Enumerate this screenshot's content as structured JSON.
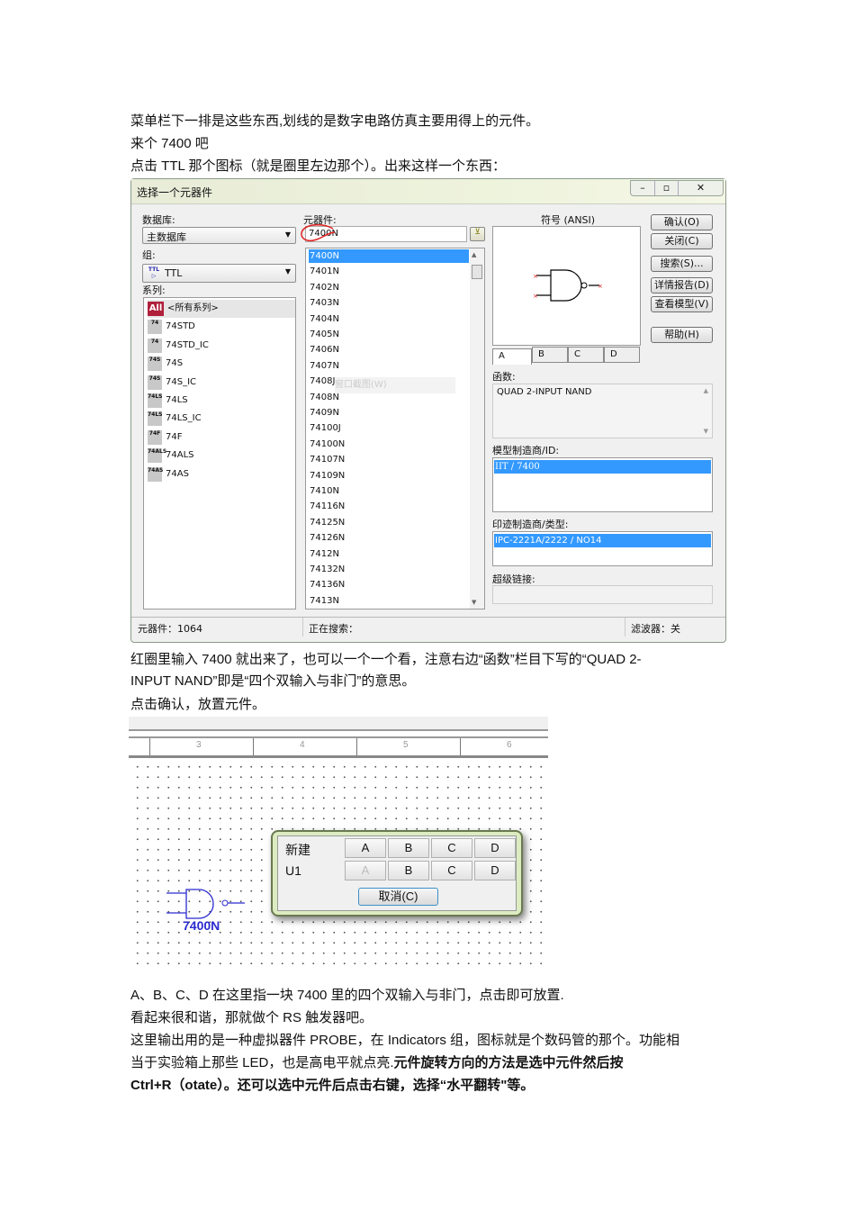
{
  "text": {
    "l1": "菜单栏下一排是这些东西,划线的是数字电路仿真主要用得上的元件。",
    "l2": "来个 7400 吧",
    "l3": "点击 TTL 那个图标（就是圈里左边那个）。出来这样一个东西：",
    "l4": "红圈里输入 7400 就出来了，也可以一个一个看，注意右边“函数”栏目下写的“QUAD 2-",
    "l5": "INPUT NAND”即是“四个双输入与非门”的意思。",
    "l6": "点击确认，放置元件。",
    "l7": "A、B、C、D 在这里指一块 7400 里的四个双输入与非门，点击即可放置.",
    "l8": "看起来很和谐，那就做个 RS 触发器吧。",
    "l9": "这里输出用的是一种虚拟器件 PROBE，在 Indicators 组，图标就是个数码管的那个。功能相",
    "l10a": "当于实验箱上那些 LED，也是高电平就点亮.",
    "l10b": "元件旋转方向的方法是选中元件然后按",
    "l11": "Ctrl+R（otate）。还可以选中元件后点击右键，选择“水平翻转\"等。"
  },
  "dialog": {
    "title": "选择一个元器件",
    "database_label": "数据库:",
    "database_value": "主数据库",
    "group_label": "组:",
    "group_value": "TTL",
    "group_icon_text": "TTL",
    "series_label": "系列:",
    "series": [
      {
        "icon": "All",
        "label": "<所有系列>"
      },
      {
        "icon": "74",
        "label": "74STD"
      },
      {
        "icon": "74",
        "label": "74STD_IC"
      },
      {
        "icon": "74S",
        "label": "74S"
      },
      {
        "icon": "74S",
        "label": "74S_IC"
      },
      {
        "icon": "74LS",
        "label": "74LS"
      },
      {
        "icon": "74LS",
        "label": "74LS_IC"
      },
      {
        "icon": "74F",
        "label": "74F"
      },
      {
        "icon": "74ALS",
        "label": "74ALS"
      },
      {
        "icon": "74AS",
        "label": "74AS"
      }
    ],
    "component_label": "元器件:",
    "component_input": "7400N",
    "components": [
      "7400N",
      "7401N",
      "7402N",
      "7403N",
      "7404N",
      "7405N",
      "7406N",
      "7407N",
      "7408J",
      "7408N",
      "7409N",
      "74100J",
      "74100N",
      "74107N",
      "74109N",
      "7410N",
      "74116N",
      "74125N",
      "74126N",
      "7412N",
      "74132N",
      "74136N",
      "7413N"
    ],
    "tooltip": "窗口截图(W)",
    "symbol_label": "符号 (ANSI)",
    "tabs": [
      "A",
      "B",
      "C",
      "D"
    ],
    "buttons": {
      "ok": "确认(O)",
      "close": "关闭(C)",
      "search": "搜索(S)...",
      "detail": "详情报告(D)",
      "model": "查看模型(V)",
      "help": "帮助(H)"
    },
    "function_label": "函数:",
    "function_value": "QUAD 2-INPUT NAND",
    "model_label": "模型制造商/ID:",
    "model_value": "IIT / 7400",
    "footprint_label": "印迹制造商/类型:",
    "footprint_value": "IPC-2221A/2222 / NO14",
    "hyperlink_label": "超级链接:",
    "status": {
      "count": "元器件：1064",
      "searching": "正在搜索：",
      "filter": "滤波器：关"
    }
  },
  "canvas": {
    "ruler": [
      "3",
      "4",
      "5",
      "6"
    ],
    "popup": {
      "row1_label": "新建",
      "row2_label": "U1",
      "cols": [
        "A",
        "B",
        "C",
        "D"
      ],
      "cancel": "取消(C)"
    },
    "part_label": "7400N"
  },
  "colors": {
    "selection": "#3399ff",
    "part": "#2a2ad0",
    "annotation": "#e02020"
  }
}
